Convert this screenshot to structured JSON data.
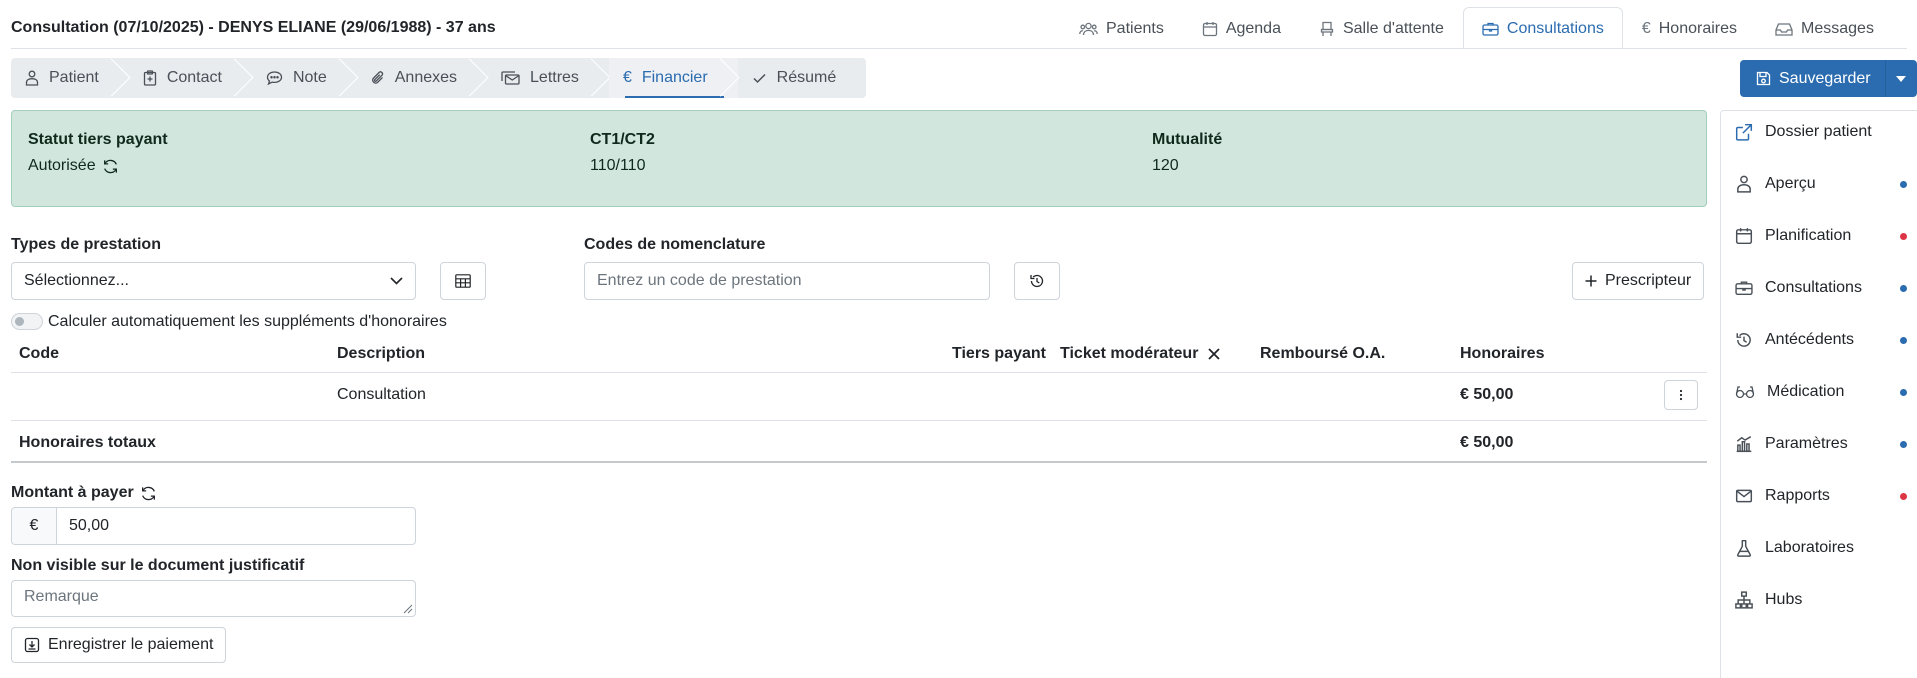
{
  "header": {
    "title": "Consultation (07/10/2025) - DENYS ELIANE (29/06/1988) - 37 ans",
    "nav": [
      {
        "label": "Patients",
        "icon": "users-icon"
      },
      {
        "label": "Agenda",
        "icon": "calendar-icon"
      },
      {
        "label": "Salle d'attente",
        "icon": "chair-icon"
      },
      {
        "label": "Consultations",
        "icon": "briefcase-icon",
        "active": true
      },
      {
        "label": "Honoraires",
        "icon": "euro-icon"
      },
      {
        "label": "Messages",
        "icon": "inbox-icon"
      }
    ]
  },
  "steps": [
    {
      "label": "Patient",
      "icon": "person-icon"
    },
    {
      "label": "Contact",
      "icon": "clipboard-icon"
    },
    {
      "label": "Note",
      "icon": "chat-icon"
    },
    {
      "label": "Annexes",
      "icon": "paperclip-icon"
    },
    {
      "label": "Lettres",
      "icon": "envelopes-icon"
    },
    {
      "label": "Financier",
      "icon": "euro-icon",
      "active": true
    },
    {
      "label": "Résumé",
      "icon": "check-icon"
    }
  ],
  "save": {
    "label": "Sauvegarder"
  },
  "status": {
    "tiers_label": "Statut tiers payant",
    "tiers_value": "Autorisée",
    "ct_label": "CT1/CT2",
    "ct_value": "110/110",
    "mutualite_label": "Mutualité",
    "mutualite_value": "120"
  },
  "sidebar": [
    {
      "label": "Dossier patient",
      "icon": "external-link-icon",
      "dot": null
    },
    {
      "label": "Aperçu",
      "icon": "person-icon",
      "dot": "#2b6cb0"
    },
    {
      "label": "Planification",
      "icon": "calendar-icon",
      "dot": "#dc3545"
    },
    {
      "label": "Consultations",
      "icon": "briefcase-icon",
      "dot": "#2b6cb0"
    },
    {
      "label": "Antécédents",
      "icon": "history-icon",
      "dot": "#2b6cb0"
    },
    {
      "label": "Médication",
      "icon": "glasses-icon",
      "dot": "#2b6cb0"
    },
    {
      "label": "Paramètres",
      "icon": "chart-icon",
      "dot": "#2b6cb0"
    },
    {
      "label": "Rapports",
      "icon": "envelope-icon",
      "dot": "#dc3545"
    },
    {
      "label": "Laboratoires",
      "icon": "flask-icon",
      "dot": null
    },
    {
      "label": "Hubs",
      "icon": "network-icon",
      "dot": null
    }
  ],
  "form": {
    "types_label": "Types de prestation",
    "types_placeholder": "Sélectionnez...",
    "codes_label": "Codes de nomenclature",
    "codes_placeholder": "Entrez un code de prestation",
    "prescripteur_label": "Prescripteur",
    "auto_calc_label": "Calculer automatiquement les suppléments d'honoraires"
  },
  "table": {
    "headers": {
      "code": "Code",
      "description": "Description",
      "tiers": "Tiers payant",
      "ticket": "Ticket modérateur",
      "rembourse": "Remboursé O.A.",
      "honoraires": "Honoraires"
    },
    "rows": [
      {
        "code": "",
        "description": "Consultation",
        "honoraires": "€ 50,00"
      }
    ],
    "total_label": "Honoraires totaux",
    "total_value": "€ 50,00"
  },
  "payment": {
    "montant_label": "Montant à payer",
    "currency": "€",
    "montant_value": "50,00",
    "remarque_label": "Non visible sur le document justificatif",
    "remarque_placeholder": "Remarque",
    "enregistrer_label": "Enregistrer le paiement"
  }
}
